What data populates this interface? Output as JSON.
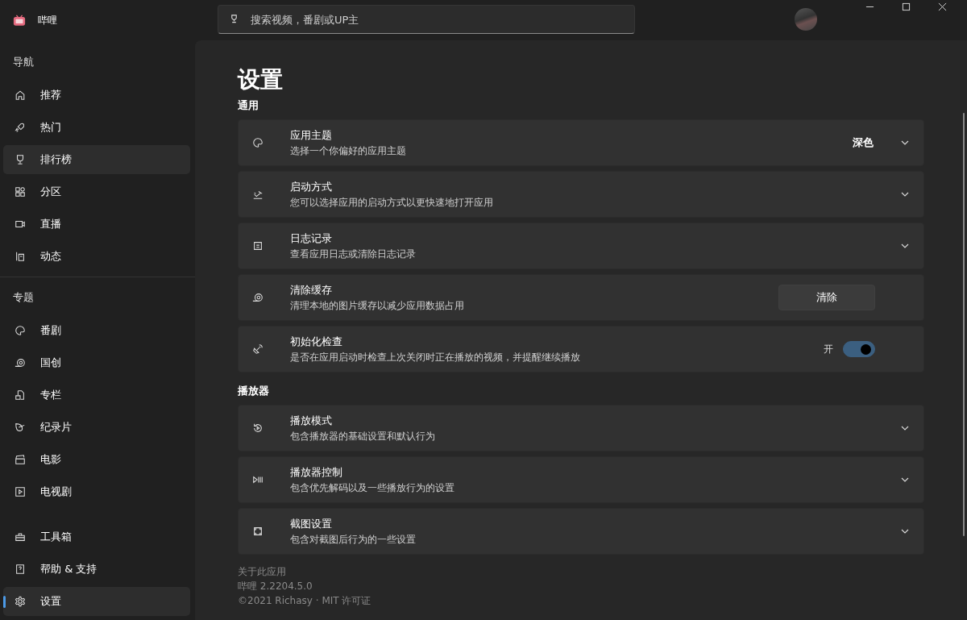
{
  "app": {
    "title": "哔哩"
  },
  "search": {
    "placeholder": "搜索视频，番剧或UP主"
  },
  "sidebar": {
    "sections": [
      {
        "heading": "导航",
        "items": [
          {
            "label": "推荐",
            "selected": false,
            "highlighted": false
          },
          {
            "label": "热门",
            "selected": false,
            "highlighted": false
          },
          {
            "label": "排行榜",
            "selected": false,
            "highlighted": true
          },
          {
            "label": "分区",
            "selected": false,
            "highlighted": false
          },
          {
            "label": "直播",
            "selected": false,
            "highlighted": false
          },
          {
            "label": "动态",
            "selected": false,
            "highlighted": false
          }
        ]
      },
      {
        "heading": "专题",
        "items": [
          {
            "label": "番剧",
            "selected": false,
            "highlighted": false
          },
          {
            "label": "国创",
            "selected": false,
            "highlighted": false
          },
          {
            "label": "专栏",
            "selected": false,
            "highlighted": false
          },
          {
            "label": "纪录片",
            "selected": false,
            "highlighted": false
          },
          {
            "label": "电影",
            "selected": false,
            "highlighted": false
          },
          {
            "label": "电视剧",
            "selected": false,
            "highlighted": false
          }
        ]
      }
    ],
    "footer_items": [
      {
        "label": "工具箱",
        "selected": false,
        "highlighted": false
      },
      {
        "label": "帮助 & 支持",
        "selected": false,
        "highlighted": false
      },
      {
        "label": "设置",
        "selected": true,
        "highlighted": true
      }
    ]
  },
  "page": {
    "title": "设置",
    "groups": [
      {
        "heading": "通用",
        "settings": [
          {
            "kind": "dropdown",
            "title": "应用主题",
            "description": "选择一个你偏好的应用主题",
            "value": "深色"
          },
          {
            "kind": "dropdown",
            "title": "启动方式",
            "description": "您可以选择应用的启动方式以更快速地打开应用"
          },
          {
            "kind": "dropdown",
            "title": "日志记录",
            "description": "查看应用日志或清除日志记录"
          },
          {
            "kind": "button",
            "title": "清除缓存",
            "description": "清理本地的图片缓存以减少应用数据占用",
            "button": "清除"
          },
          {
            "kind": "toggle",
            "title": "初始化检查",
            "description": "是否在应用启动时检查上次关闭时正在播放的视频，并提醒继续播放",
            "state_label": "开",
            "on": true
          }
        ]
      },
      {
        "heading": "播放器",
        "settings": [
          {
            "kind": "dropdown",
            "title": "播放模式",
            "description": "包含播放器的基础设置和默认行为"
          },
          {
            "kind": "dropdown",
            "title": "播放器控制",
            "description": "包含优先解码以及一些播放行为的设置"
          },
          {
            "kind": "dropdown",
            "title": "截图设置",
            "description": "包含对截图后行为的一些设置"
          }
        ]
      }
    ],
    "about": {
      "heading": "关于此应用",
      "version": "哔哩 2.2204.5.0",
      "copyright": "©2021 Richasy · MIT 许可证"
    }
  }
}
